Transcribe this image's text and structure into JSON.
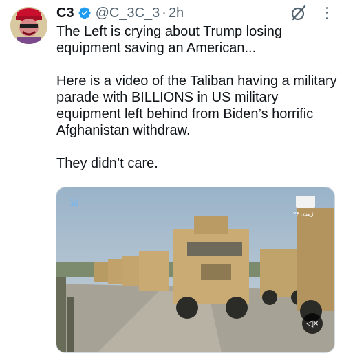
{
  "tweet": {
    "display_name": "C3",
    "handle": "@C_3C_3",
    "separator": "·",
    "time": "2h",
    "paragraphs": [
      "The Left is crying about Trump losing equipment saving an American...",
      "Here is a video of the Taliban having a military parade with BILLIONS in US military equipment left behind from Biden’s horrific Afghanistan withdraw.",
      "They didn’t care."
    ]
  },
  "media": {
    "watermark_left": "ئلا",
    "channel_text": "ژمدی ۲۴",
    "mute_label": "◁×"
  },
  "icons": {
    "verified": "verified-badge-icon",
    "grok": "grok-icon",
    "more": "more-icon",
    "mute": "volume-muted-icon"
  },
  "colors": {
    "verified": "#1d9bf0",
    "secondary_text": "#536471",
    "primary_text": "#0f1419"
  }
}
